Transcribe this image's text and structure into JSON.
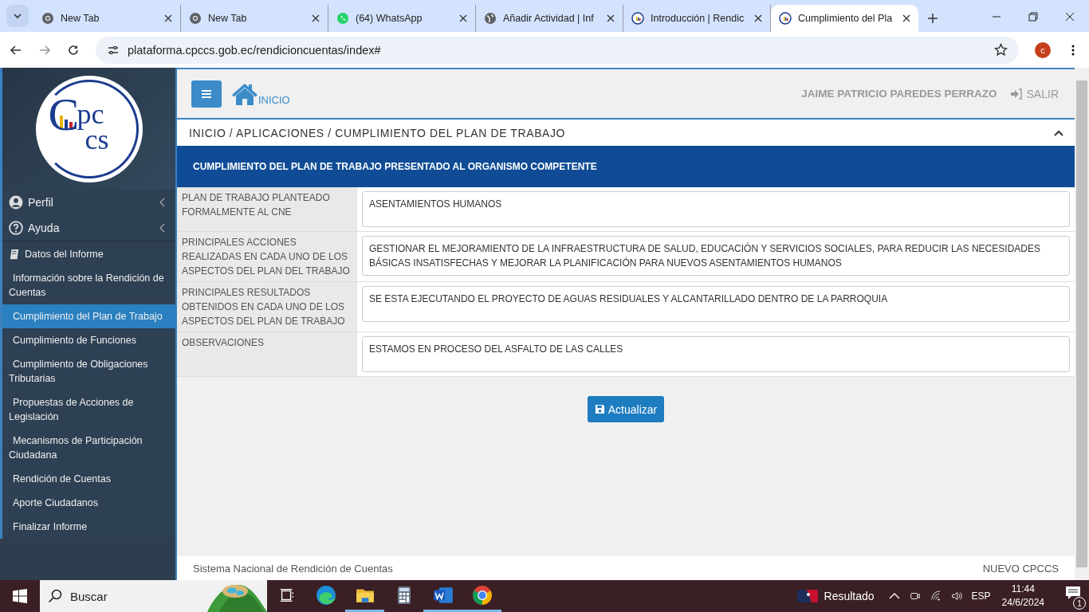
{
  "browser": {
    "tabs": [
      {
        "title": "New Tab",
        "kind": "chrome",
        "selected": false
      },
      {
        "title": "New Tab",
        "kind": "chrome",
        "selected": false
      },
      {
        "title": "(64) WhatsApp",
        "kind": "whatsapp",
        "selected": false
      },
      {
        "title": "Añadir Actividad | Inf",
        "kind": "globe",
        "selected": false
      },
      {
        "title": "Introducción | Rendic",
        "kind": "cpccs",
        "selected": false
      },
      {
        "title": "Cumplimiento del Pla",
        "kind": "cpccs",
        "selected": true
      }
    ],
    "address": "plataforma.cpccs.gob.ec/rendicioncuentas/index#",
    "profile_initial": "c"
  },
  "logo": {
    "letters": [
      "C",
      "pc",
      "cs"
    ]
  },
  "sidebar": {
    "sections": [
      {
        "label": "Perfil",
        "kind": "user",
        "expandable": true
      },
      {
        "label": "Ayuda",
        "kind": "help",
        "expandable": true
      },
      {
        "label": "Datos del Informe",
        "kind": "book",
        "expandable": false
      }
    ],
    "items": [
      {
        "label": "Información sobre la Rendición de Cuentas",
        "selected": false
      },
      {
        "label": "Cumplimiento del Plan de Trabajo",
        "selected": true
      },
      {
        "label": "Cumplimiento de Funciones",
        "selected": false
      },
      {
        "label": "Cumplimiento de Obligaciones Tributarias",
        "selected": false
      },
      {
        "label": "Propuestas de Acciones de Legislación",
        "selected": false
      },
      {
        "label": "Mecanismos de Participación Ciudadana",
        "selected": false
      },
      {
        "label": "Rendición de Cuentas",
        "selected": false
      },
      {
        "label": "Aporte Ciudadanos",
        "selected": false
      },
      {
        "label": "Finalizar Informe",
        "selected": false
      }
    ]
  },
  "header": {
    "home_label": "INICIO",
    "user": "JAIME PATRICIO PAREDES PERRAZO",
    "logout": "SALIR"
  },
  "breadcrumb": "INICIO / APLICACIONES / CUMPLIMIENTO DEL PLAN DE TRABAJO",
  "panel": {
    "title": "CUMPLIMIENTO DEL PLAN DE TRABAJO PRESENTADO AL ORGANISMO COMPETENTE",
    "rows": [
      {
        "label": "PLAN DE TRABAJO PLANTEADO FORMALMENTE AL CNE",
        "value": "ASENTAMIENTOS HUMANOS"
      },
      {
        "label": "PRINCIPALES ACCIONES REALIZADAS EN CADA UNO DE LOS ASPECTOS DEL PLAN DEL TRABAJO",
        "value": "GESTIONAR EL MEJORAMIENTO DE LA INFRAESTRUCTURA  DE SALUD, EDUCACIÓN Y SERVICIOS SOCIALES, PARA REDUCIR LAS NECESIDADES BÁSICAS INSATISFECHAS Y MEJORAR LA PLANIFICACIÓN PARA NUEVOS ASENTAMIENTOS HUMANOS"
      },
      {
        "label": "PRINCIPALES RESULTADOS OBTENIDOS EN CADA UNO DE LOS ASPECTOS DEL PLAN DE TRABAJO",
        "value": "SE ESTA EJECUTANDO EL PROYECTO DE AGUAS RESIDUALES Y ALCANTARILLADO DENTRO DE LA PARROQUIA"
      },
      {
        "label": "OBSERVACIONES",
        "value": "ESTAMOS EN PROCESO DEL ASFALTO DE LAS CALLES"
      }
    ],
    "button": "Actualizar"
  },
  "footer": {
    "left": "Sistema Nacional de Rendición de Cuentas",
    "right": "NUEVO CPCCS"
  },
  "taskbar": {
    "search_placeholder": "Buscar",
    "apps": [
      {
        "kind": "taskview",
        "open": false
      },
      {
        "kind": "edge",
        "open": false
      },
      {
        "kind": "folder",
        "open": true
      },
      {
        "kind": "calculator",
        "open": false
      },
      {
        "kind": "word",
        "open": true
      },
      {
        "kind": "chrome",
        "open": true
      }
    ],
    "weather": "Resultado",
    "language": "ESP",
    "time": "11:44",
    "date": "24/6/2024",
    "notifications": "1"
  }
}
